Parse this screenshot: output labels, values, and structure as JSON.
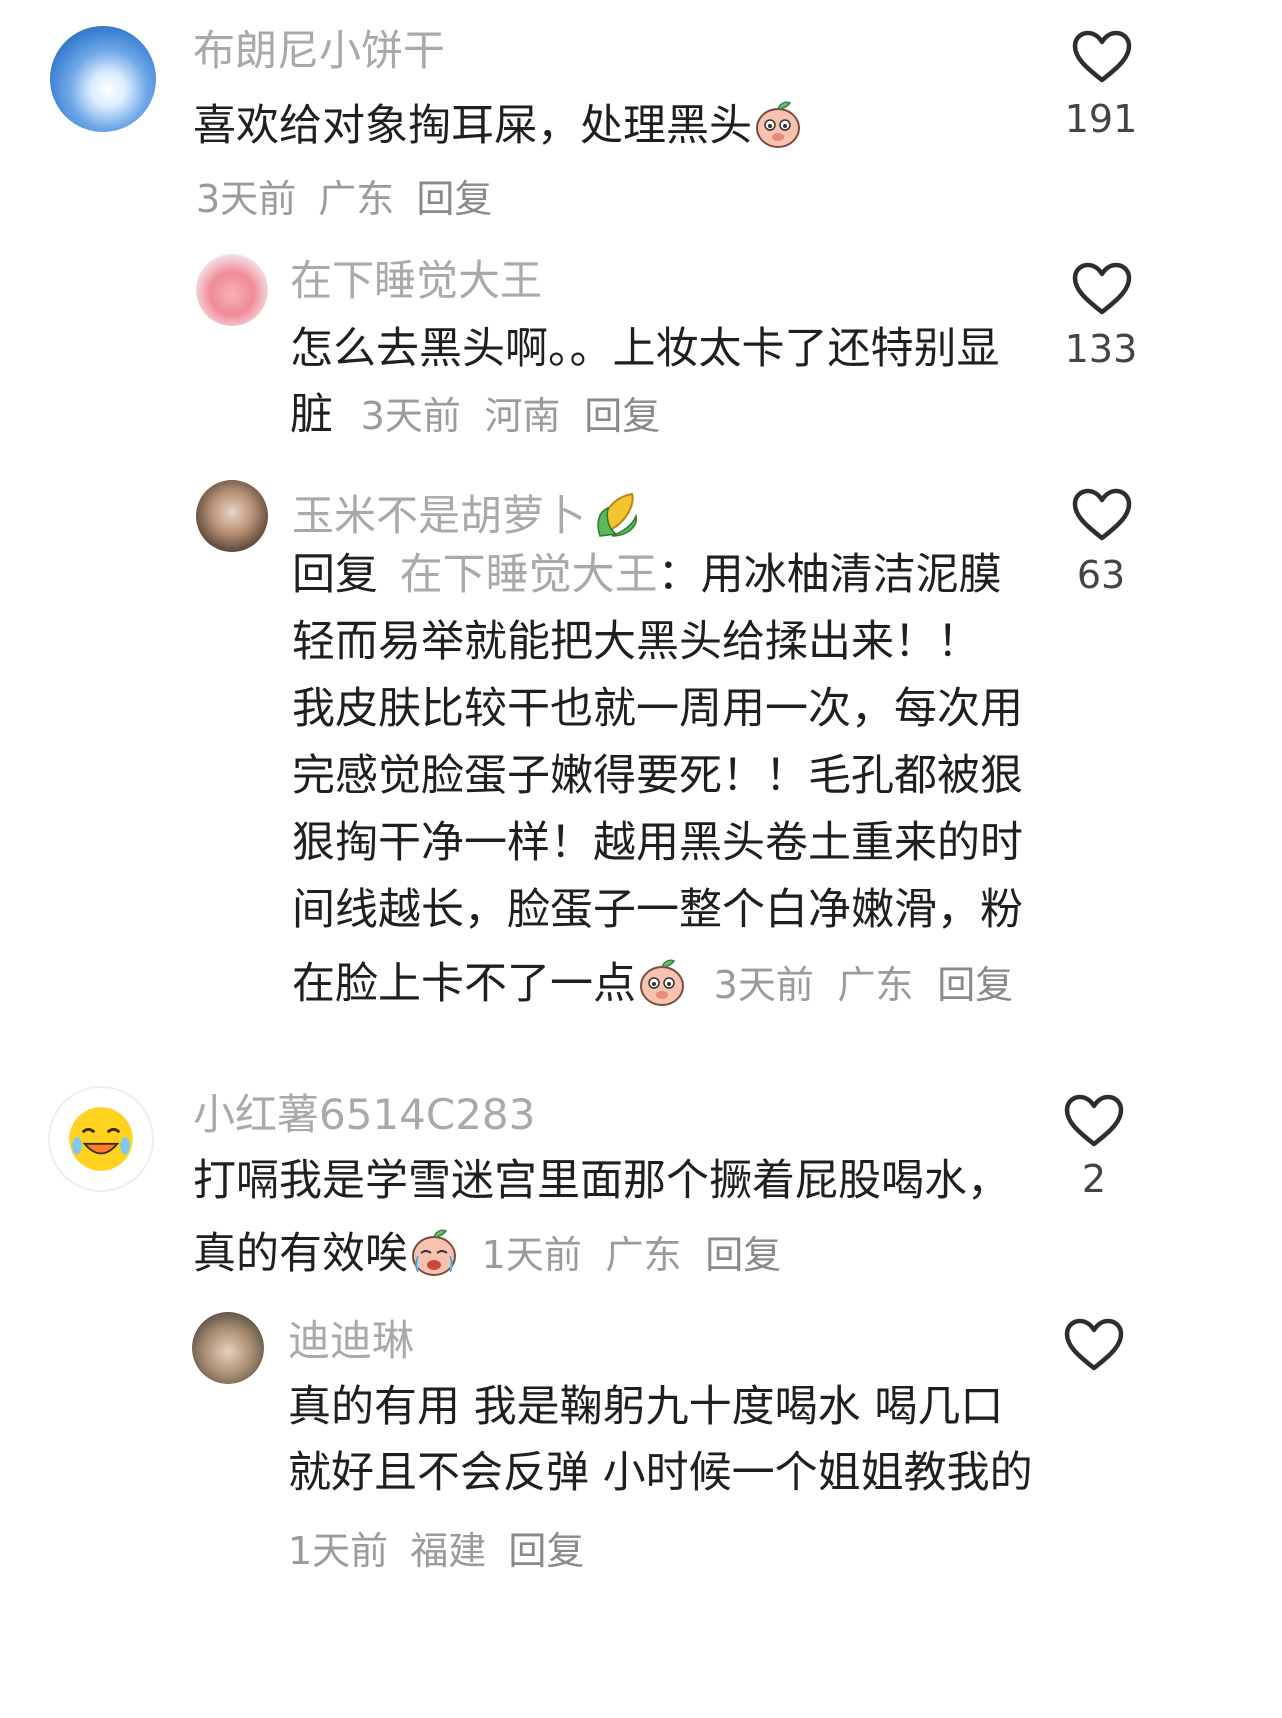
{
  "comments": [
    {
      "username": "布朗尼小饼干",
      "text": "喜欢给对象掏耳屎，处理黑头",
      "time": "3天前",
      "location": "广东",
      "reply_label": "回复",
      "likes": "191"
    },
    {
      "username": "在下睡觉大王",
      "text_line1": "怎么去黑头啊。。上妆太卡了还特别显",
      "text_line2": "脏",
      "time": "3天前",
      "location": "河南",
      "reply_label": "回复",
      "likes": "133"
    },
    {
      "username": "玉米不是胡萝卜",
      "reply_prefix": "回复",
      "reply_to": "在下睡觉大王",
      "reply_colon": "：",
      "lines": [
        "用冰柚清洁泥膜",
        "轻而易举就能把大黑头给揉出来！！",
        "我皮肤比较干也就一周用一次，每次用",
        "完感觉脸蛋子嫩得要死！！毛孔都被狠",
        "狠掏干净一样！越用黑头卷土重来的时",
        "间线越长，脸蛋子一整个白净嫩滑，粉",
        "在脸上卡不了一点"
      ],
      "time": "3天前",
      "location": "广东",
      "reply_label": "回复",
      "likes": "63"
    },
    {
      "username": "小红薯6514C283",
      "text_line1": "打嗝我是学雪迷宫里面那个撅着屁股喝水，",
      "text_line2": "真的有效唉",
      "time": "1天前",
      "location": "广东",
      "reply_label": "回复",
      "likes": "2"
    },
    {
      "username": "迪迪琳",
      "text_line1": "真的有用 我是鞠躬九十度喝水 喝几口",
      "text_line2": "就好且不会反弹 小时候一个姐姐教我的",
      "time": "1天前",
      "location": "福建",
      "reply_label": "回复"
    }
  ],
  "icons": {
    "like": "heart-outline-icon",
    "peach_emoji": "blushing-peach-emoji",
    "corn_emoji": "corn-emoji",
    "crying_peach_emoji": "crying-peach-emoji"
  },
  "colors": {
    "username": "#a9a9a9",
    "meta": "#9b9b9b",
    "text": "#1f1f1f"
  }
}
